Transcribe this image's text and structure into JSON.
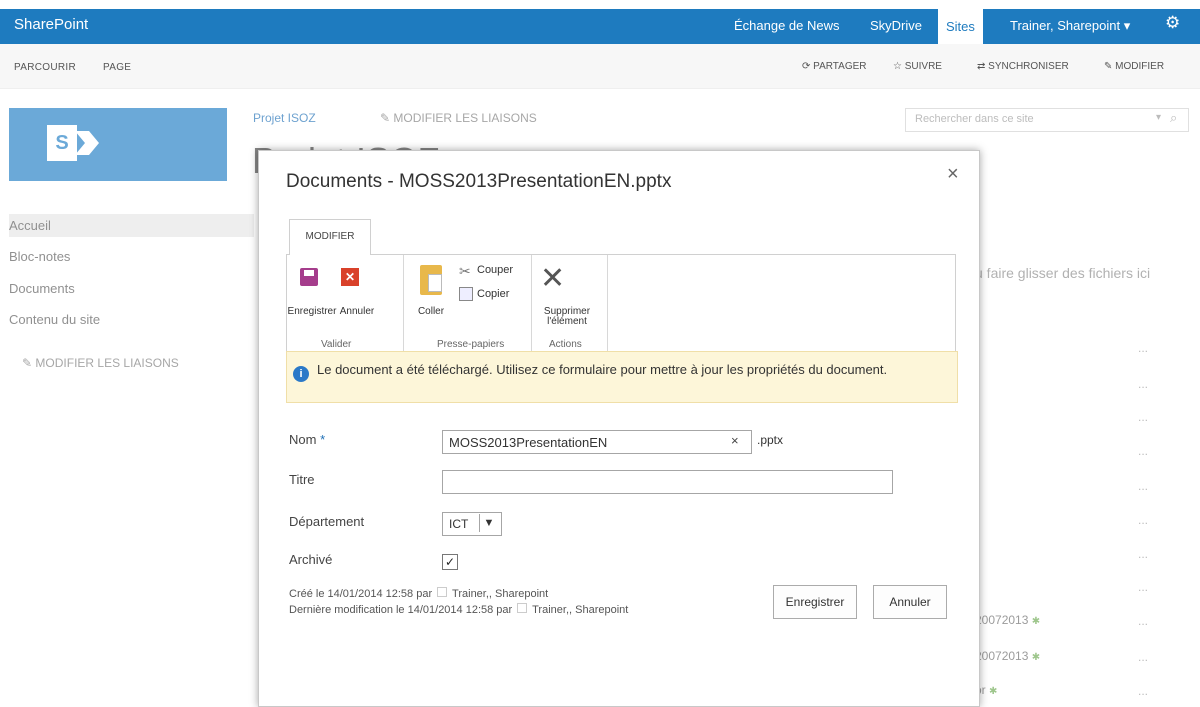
{
  "suitebar": {
    "brand": "SharePoint",
    "links": [
      "Échange de News",
      "SkyDrive",
      "Sites"
    ],
    "user": "Trainer, Sharepoint",
    "user_caret": "▾"
  },
  "ribbon_row": {
    "tabs": [
      "PARCOURIR",
      "PAGE"
    ],
    "actions": [
      "PARTAGER",
      "SUIVRE",
      "SYNCHRONISER",
      "MODIFIER"
    ]
  },
  "leftnav": {
    "items": [
      "Accueil",
      "Bloc-notes",
      "Documents",
      "Contenu du site"
    ],
    "edit_links": "MODIFIER LES LIAISONS"
  },
  "page": {
    "breadcrumb": "Projet ISOZ",
    "breadcrumb_edit": "MODIFIER LES LIAISONS",
    "search_placeholder": "Rechercher dans ce site",
    "title_partial": "Projet ISOZ",
    "dropzone_partial": "u faire glisser des fichiers ici",
    "row_texts": [
      "20072013",
      "20072013",
      "or"
    ],
    "dots": "..."
  },
  "dialog": {
    "title": "Documents - MOSS2013PresentationEN.pptx",
    "close": "×",
    "ribbon_tab": "MODIFIER",
    "buttons": {
      "save": "Enregistrer",
      "cancel": "Annuler",
      "paste": "Coller",
      "cut": "Couper",
      "copy": "Copier",
      "delete_1": "Supprimer",
      "delete_2": "l'élément"
    },
    "groups": [
      "Valider",
      "Presse-papiers",
      "Actions"
    ],
    "info": "Le document a été téléchargé. Utilisez ce formulaire pour mettre à jour les propriétés du document.",
    "fields": {
      "name_label": "Nom",
      "name_required": "*",
      "name_value": "MOSS2013PresentationEN",
      "name_clear": "×",
      "ext": ".pptx",
      "title_label": "Titre",
      "title_value": "",
      "dept_label": "Département",
      "dept_value": "ICT",
      "archived_label": "Archivé",
      "archived_checked": true
    },
    "meta": {
      "created": "Créé le 14/01/2014 12:58  par",
      "created_by": "Trainer,, Sharepoint",
      "modified": "Dernière modification le 14/01/2014 12:58  par",
      "modified_by": "Trainer,, Sharepoint"
    },
    "footer_buttons": {
      "save": "Enregistrer",
      "cancel": "Annuler"
    }
  }
}
